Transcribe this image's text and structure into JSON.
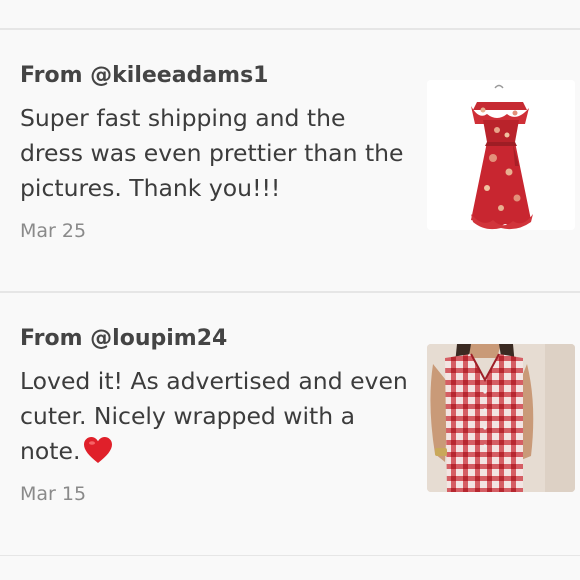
{
  "reviews": [
    {
      "from": "From @kileeadams1",
      "message": "Super fast shipping and the dress was even prettier than the pictures. Thank you!!!",
      "date": "Mar 25",
      "thumbnail": "red-floral-maxi-dress-photo"
    },
    {
      "from": "From @loupim24",
      "message": "Loved it! As advertised and even cuter. Nicely wrapped with a note.",
      "emoji": "heart-icon",
      "date": "Mar 15",
      "thumbnail": "red-gingham-dress-model-photo"
    }
  ],
  "colors": {
    "background": "#f9f9f9",
    "divider": "#e6e6e6",
    "heart": "#e0202a",
    "dress_red": "#c8252f"
  }
}
